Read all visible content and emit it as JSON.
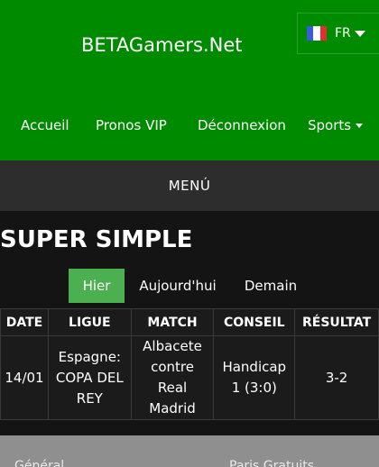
{
  "brand": "BETAGamers.Net",
  "language": {
    "code": "FR",
    "flag_colors": [
      "#3b5bdb",
      "#ffffff",
      "#e03131"
    ]
  },
  "nav": {
    "items": [
      "Accueil",
      "Pronos VIP",
      "Déconnexion",
      "Sports"
    ]
  },
  "menu_label": "MENÚ",
  "section_title": "SUPER SIMPLE",
  "day_tabs": [
    "Hier",
    "Aujourd'hui",
    "Demain"
  ],
  "active_tab": "Hier",
  "table": {
    "headers": [
      "DATE",
      "LIGUE",
      "MATCH",
      "CONSEIL",
      "RÉSULTAT"
    ],
    "rows": [
      {
        "date": "14/01",
        "league": "Espagne: COPA DEL REY",
        "match": "Albacete contre Real Madrid",
        "advice": "Handicap 1 (3:0)",
        "result": "3-2"
      }
    ]
  },
  "footer": {
    "left": "Général",
    "right": "Paris Gratuits"
  },
  "colors": {
    "header_green": "#008a00",
    "active_tab_green": "#4caf50",
    "menubar": "#2d2d2d",
    "background": "#141414"
  }
}
